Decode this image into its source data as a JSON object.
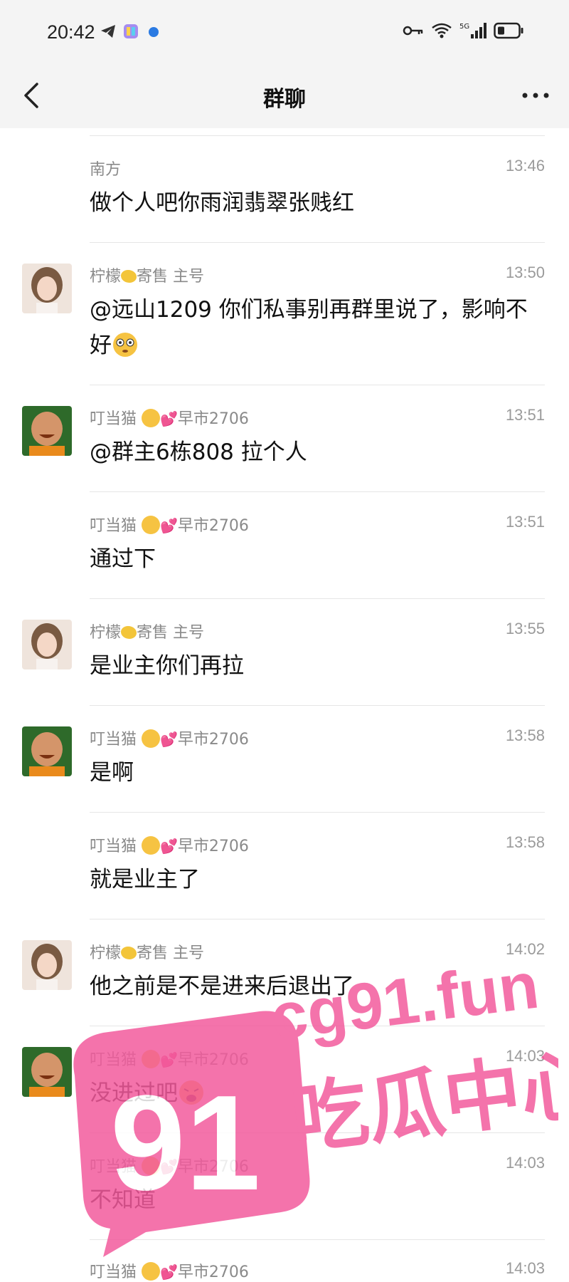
{
  "status_bar": {
    "time": "20:42",
    "network": "5G"
  },
  "header": {
    "title": "群聊"
  },
  "messages": [
    {
      "sender": "南方",
      "time": "13:46",
      "text": "做个人吧你雨润翡翠张贱红",
      "avatar": "none"
    },
    {
      "sender": "柠檬",
      "sender_suffix": "寄售 主号",
      "time": "13:50",
      "text": "@远山1209 你们私事别再群里说了，影响不好",
      "avatar": "woman"
    },
    {
      "sender": "叮当猫",
      "sender_suffix": "早市2706",
      "time": "13:51",
      "text": "@群主6栋808 拉个人",
      "avatar": "monk"
    },
    {
      "sender": "叮当猫",
      "sender_suffix": "早市2706",
      "time": "13:51",
      "text": "通过下",
      "avatar": "none"
    },
    {
      "sender": "柠檬",
      "sender_suffix": "寄售 主号",
      "time": "13:55",
      "text": "是业主你们再拉",
      "avatar": "woman"
    },
    {
      "sender": "叮当猫",
      "sender_suffix": "早市2706",
      "time": "13:58",
      "text": "是啊",
      "avatar": "monk"
    },
    {
      "sender": "叮当猫",
      "sender_suffix": "早市2706",
      "time": "13:58",
      "text": "就是业主了",
      "avatar": "none"
    },
    {
      "sender": "柠檬",
      "sender_suffix": "寄售 主号",
      "time": "14:02",
      "text": "他之前是不是进来后退出了",
      "avatar": "woman"
    },
    {
      "sender": "叮当猫",
      "sender_suffix": "早市2706",
      "time": "14:03",
      "text": "没进过吧",
      "avatar": "monk"
    },
    {
      "sender": "叮当猫",
      "sender_suffix": "早市2706",
      "time": "14:03",
      "text": "不知道",
      "avatar": "none"
    },
    {
      "sender": "叮当猫",
      "sender_suffix": "早市2706",
      "time": "14:03",
      "text": "",
      "avatar": "none"
    }
  ],
  "watermark": {
    "number": "91",
    "domain": "cg91.fun",
    "slogan": "吃瓜中心",
    "color": "#f25a9c"
  },
  "colors": {
    "background": "#ffffff",
    "bar": "#f4f4f4",
    "meta_text": "#8a8a8a",
    "divider": "#e6e6e6"
  }
}
